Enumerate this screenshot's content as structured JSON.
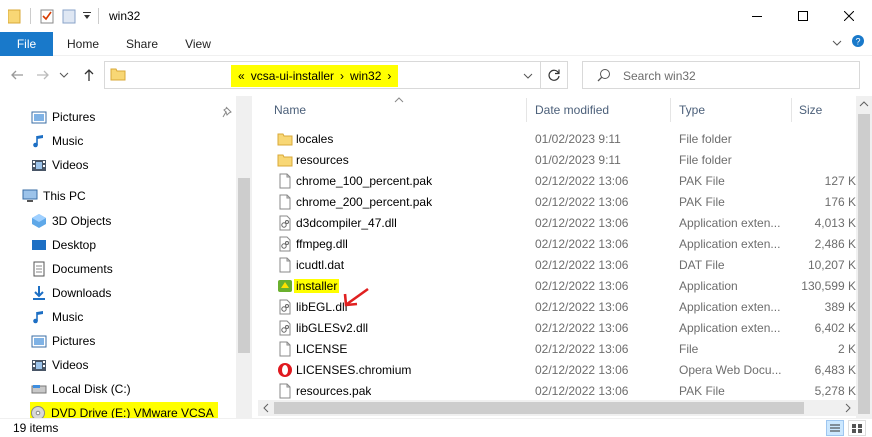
{
  "window": {
    "title": "win32"
  },
  "ribbon": {
    "tabs": [
      "File",
      "Home",
      "Share",
      "View"
    ]
  },
  "address": {
    "prefix": "«",
    "crumbs": [
      "vcsa-ui-installer",
      "win32"
    ],
    "search_placeholder": "Search win32"
  },
  "nav": {
    "items": [
      {
        "label": "Pictures",
        "icon": "pictures-icon"
      },
      {
        "label": "Music",
        "icon": "music-icon"
      },
      {
        "label": "Videos",
        "icon": "videos-icon"
      },
      {
        "label": "This PC",
        "icon": "this-pc-icon"
      },
      {
        "label": "3D Objects",
        "icon": "3d-objects-icon"
      },
      {
        "label": "Desktop",
        "icon": "desktop-icon"
      },
      {
        "label": "Documents",
        "icon": "documents-icon"
      },
      {
        "label": "Downloads",
        "icon": "downloads-icon"
      },
      {
        "label": "Music",
        "icon": "music-icon"
      },
      {
        "label": "Pictures",
        "icon": "pictures-icon"
      },
      {
        "label": "Videos",
        "icon": "videos-icon"
      },
      {
        "label": "Local Disk (C:)",
        "icon": "local-disk-icon"
      },
      {
        "label": "DVD Drive (E:) VMware VCSA",
        "icon": "dvd-drive-icon"
      }
    ]
  },
  "columns": {
    "name": "Name",
    "date": "Date modified",
    "type": "Type",
    "size": "Size"
  },
  "files": [
    {
      "name": "locales",
      "date": "01/02/2023 9:11",
      "type": "File folder",
      "size": "",
      "kind": "folder"
    },
    {
      "name": "resources",
      "date": "01/02/2023 9:11",
      "type": "File folder",
      "size": "",
      "kind": "folder"
    },
    {
      "name": "chrome_100_percent.pak",
      "date": "02/12/2022 13:06",
      "type": "PAK File",
      "size": "127 K",
      "kind": "file"
    },
    {
      "name": "chrome_200_percent.pak",
      "date": "02/12/2022 13:06",
      "type": "PAK File",
      "size": "176 K",
      "kind": "file"
    },
    {
      "name": "d3dcompiler_47.dll",
      "date": "02/12/2022 13:06",
      "type": "Application exten...",
      "size": "4,013 K",
      "kind": "dll"
    },
    {
      "name": "ffmpeg.dll",
      "date": "02/12/2022 13:06",
      "type": "Application exten...",
      "size": "2,486 K",
      "kind": "dll"
    },
    {
      "name": "icudtl.dat",
      "date": "02/12/2022 13:06",
      "type": "DAT File",
      "size": "10,207 K",
      "kind": "file"
    },
    {
      "name": "installer",
      "date": "02/12/2022 13:06",
      "type": "Application",
      "size": "130,599 K",
      "kind": "app"
    },
    {
      "name": "libEGL.dll",
      "date": "02/12/2022 13:06",
      "type": "Application exten...",
      "size": "389 K",
      "kind": "dll"
    },
    {
      "name": "libGLESv2.dll",
      "date": "02/12/2022 13:06",
      "type": "Application exten...",
      "size": "6,402 K",
      "kind": "dll"
    },
    {
      "name": "LICENSE",
      "date": "02/12/2022 13:06",
      "type": "File",
      "size": "2 K",
      "kind": "file"
    },
    {
      "name": "LICENSES.chromium",
      "date": "02/12/2022 13:06",
      "type": "Opera Web Docu...",
      "size": "6,483 K",
      "kind": "opera"
    },
    {
      "name": "resources.pak",
      "date": "02/12/2022 13:06",
      "type": "PAK File",
      "size": "5,278 K",
      "kind": "file"
    }
  ],
  "status": {
    "count": "19 items"
  },
  "colors": {
    "accent": "#1979ca",
    "highlight": "#ffff00",
    "annotation": "#e02020",
    "folder": "#f8d775"
  }
}
